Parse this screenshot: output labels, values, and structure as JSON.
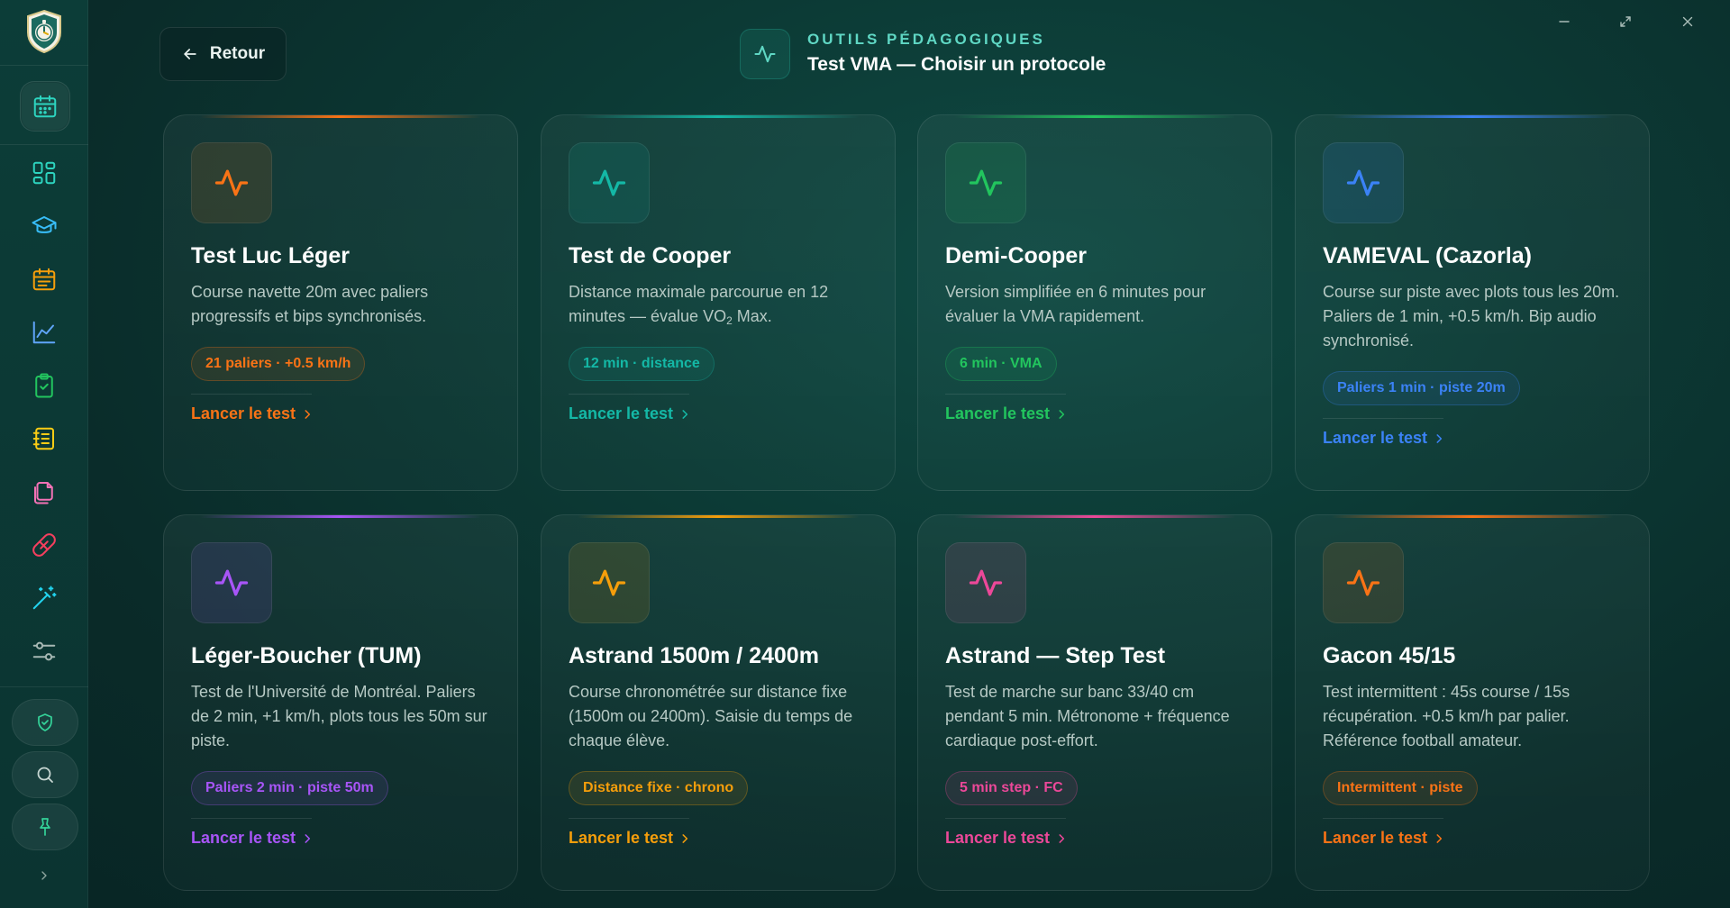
{
  "header": {
    "back_label": "Retour",
    "eyebrow": "OUTILS PÉDAGOGIQUES",
    "title": "Test VMA — Choisir un protocole",
    "icon": "activity-icon"
  },
  "window_controls": [
    "minimize-icon",
    "maximize-icon",
    "close-icon"
  ],
  "sidebar": {
    "logo": "stopwatch-shield-logo",
    "items": [
      {
        "icon": "calendar-icon",
        "color": "#2dd4bf",
        "active": true
      },
      {
        "icon": "dashboard-icon",
        "color": "#2dd4bf"
      },
      {
        "icon": "graduation-cap-icon",
        "color": "#38bdf8"
      },
      {
        "icon": "calendar-list-icon",
        "color": "#f59e0b"
      },
      {
        "icon": "line-chart-icon",
        "color": "#60a5fa"
      },
      {
        "icon": "clipboard-check-icon",
        "color": "#22c55e"
      },
      {
        "icon": "notebook-icon",
        "color": "#facc15"
      },
      {
        "icon": "copy-files-icon",
        "color": "#f472b6"
      },
      {
        "icon": "bandage-icon",
        "color": "#f43f5e"
      },
      {
        "icon": "magic-wand-icon",
        "color": "#22d3ee"
      },
      {
        "icon": "sliders-icon",
        "color": "#a7b8b4"
      }
    ],
    "bottom": [
      {
        "icon": "shield-check-icon",
        "color": "#34d399"
      },
      {
        "icon": "search-icon",
        "color": "#c7d6d2"
      },
      {
        "icon": "pin-icon",
        "color": "#34d399"
      }
    ]
  },
  "cards": [
    {
      "title": "Test Luc Léger",
      "desc": "Course navette 20m avec paliers progressifs et bips synchronisés.",
      "tag": "21 paliers · +0.5 km/h",
      "link": "Lancer le test",
      "color": "#f97316",
      "accent": "#f97316"
    },
    {
      "title": "Test de Cooper",
      "desc_pre": "Distance maximale parcourue en 12 minutes — évalue VO",
      "desc_sub": "2",
      "desc_post": " Max.",
      "tag": "12 min · distance",
      "link": "Lancer le test",
      "color": "#14b8a6",
      "accent": "#14b8a6"
    },
    {
      "title": "Demi-Cooper",
      "desc": "Version simplifiée en 6 minutes pour évaluer la VMA rapidement.",
      "tag": "6 min · VMA",
      "link": "Lancer le test",
      "color": "#22c55e",
      "accent": "#22c55e"
    },
    {
      "title": "VAMEVAL (Cazorla)",
      "desc": "Course sur piste avec plots tous les 20m. Paliers de 1 min, +0.5 km/h. Bip audio synchronisé.",
      "tag": "Paliers 1 min · piste 20m",
      "link": "Lancer le test",
      "color": "#3b82f6",
      "accent": "#3b82f6"
    },
    {
      "title": "Léger-Boucher (TUM)",
      "desc": "Test de l'Université de Montréal. Paliers de 2 min, +1 km/h, plots tous les 50m sur piste.",
      "tag": "Paliers 2 min · piste 50m",
      "link": "Lancer le test",
      "color": "#a855f7",
      "accent": "#a855f7"
    },
    {
      "title": "Astrand 1500m / 2400m",
      "desc": "Course chronométrée sur distance fixe (1500m ou 2400m). Saisie du temps de chaque élève.",
      "tag": "Distance fixe · chrono",
      "link": "Lancer le test",
      "color": "#f59e0b",
      "accent": "#f59e0b"
    },
    {
      "title": "Astrand — Step Test",
      "desc": "Test de marche sur banc 33/40 cm pendant 5 min. Métronome + fréquence cardiaque post-effort.",
      "tag": "5 min step · FC",
      "link": "Lancer le test",
      "color": "#ec4899",
      "accent": "#ec4899"
    },
    {
      "title": "Gacon 45/15",
      "desc": "Test intermittent : 45s course / 15s récupération. +0.5 km/h par palier. Référence football amateur.",
      "tag": "Intermittent · piste",
      "link": "Lancer le test",
      "color": "#f97316",
      "accent": "#f97316"
    }
  ]
}
